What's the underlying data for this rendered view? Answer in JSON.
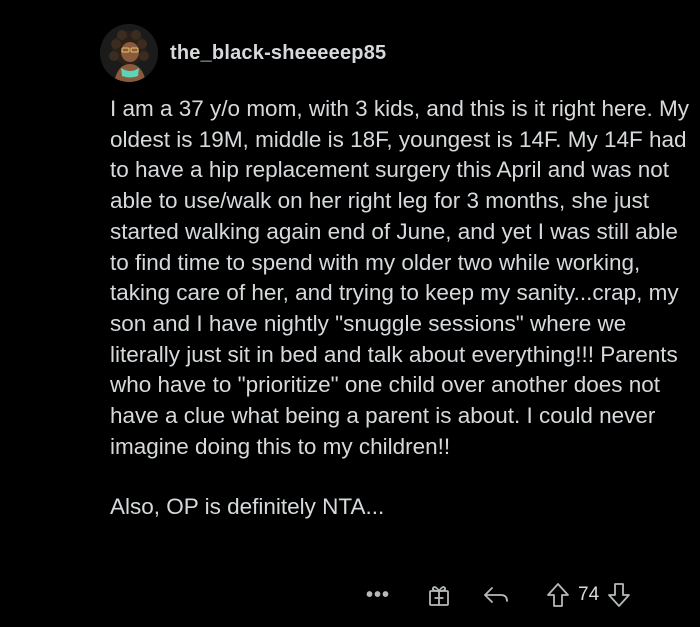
{
  "comment": {
    "username": "the_black-sheeeeep85",
    "paragraphs": [
      "I am a 37 y/o mom, with 3 kids, and this is it right here. My oldest is 19M, middle is 18F, youngest is 14F. My 14F had to have a hip replacement surgery this April and was not able to use/walk on her right leg for 3 months, she just started walking again end of June, and yet I was still able to find time to spend with my older two while working, taking care of her, and trying to keep my sanity...crap, my son and I have nightly \"snuggle sessions\" where we literally just sit in bed and talk about everything!!! Parents who have to \"prioritize\" one child over another does not have a clue what being a parent is about. I could never imagine doing this to my children!!",
      "Also, OP is definitely NTA..."
    ],
    "vote_count": "74"
  },
  "actions": {
    "more_label": "•••",
    "icons": {
      "more": "more-options-icon",
      "gift": "gift-icon",
      "reply": "reply-icon",
      "upvote": "upvote-arrow-icon",
      "downvote": "downvote-arrow-icon"
    }
  },
  "colors": {
    "background": "#000000",
    "text": "#d7dadc",
    "icon": "#b6b9bb"
  }
}
